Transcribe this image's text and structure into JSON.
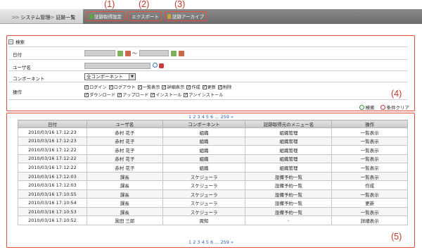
{
  "callouts": [
    "(1)",
    "(2)",
    "(3)",
    "(4)",
    "(5)"
  ],
  "breadcrumb": {
    "root": "システム管理",
    "current": "証跡一覧"
  },
  "tabs": [
    {
      "label": "証跡取得設定",
      "icon": "settings-icon"
    },
    {
      "label": "エクスポート",
      "icon": "export-icon"
    },
    {
      "label": "証跡アーカイブ",
      "icon": "archive-icon"
    }
  ],
  "search": {
    "title": "検索",
    "date_label": "日付",
    "date_separator": "〜",
    "user_label": "ユーザ名",
    "component_label": "コンポーネント",
    "component_value": "全コンポーネント",
    "operation_label": "操作",
    "operations": [
      "ログイン",
      "ログアウト",
      "一覧表示",
      "詳細表示",
      "作成",
      "更新",
      "削除",
      "ダウンロード",
      "アップロード",
      "インストール",
      "アンインストール"
    ],
    "search_button": "検索",
    "clear_button": "条件クリア"
  },
  "pager": "1 2 3 4 5 6 ... 259 »",
  "results": {
    "columns": [
      "日付",
      "ユーザ名",
      "コンポーネント",
      "証跡取得元のメニュー名",
      "操作"
    ],
    "rows": [
      [
        "2010/03/16 17:12:23",
        "赤村 花子",
        "組織",
        "組織管理",
        "一覧表示"
      ],
      [
        "2010/03/16 17:12:23",
        "赤村 花子",
        "組織",
        "組織管理",
        "一覧表示"
      ],
      [
        "2010/03/16 17:12:22",
        "赤村 花子",
        "組織",
        "組織管理",
        "一覧表示"
      ],
      [
        "2010/03/16 17:12:22",
        "赤村 花子",
        "組織",
        "組織管理",
        "一覧表示"
      ],
      [
        "2010/03/16 17:12:22",
        "赤村 花子",
        "組織",
        "組織管理",
        "一覧表示"
      ],
      [
        "2010/03/16 17:12:03",
        "課長",
        "スケジューラ",
        "設備予約一覧",
        "一覧表示"
      ],
      [
        "2010/03/16 17:12:03",
        "課長",
        "スケジューラ",
        "設備予約一覧",
        "作成"
      ],
      [
        "2010/03/16 17:10:55",
        "課長",
        "スケジューラ",
        "設備予約一覧",
        "一覧表示"
      ],
      [
        "2010/03/16 17:10:54",
        "課長",
        "スケジューラ",
        "設備予約一覧",
        "更新"
      ],
      [
        "2010/03/16 17:10:53",
        "課長",
        "スケジューラ",
        "設備予約一覧",
        "一覧表示"
      ],
      [
        "2010/03/16 17:10:52",
        "黒田 三郎",
        "周知",
        "-",
        "詳細表示"
      ]
    ]
  },
  "colors": {
    "callout": "#c0392b",
    "tab_bar": "#7a7a7a",
    "link": "#2a5db0"
  }
}
